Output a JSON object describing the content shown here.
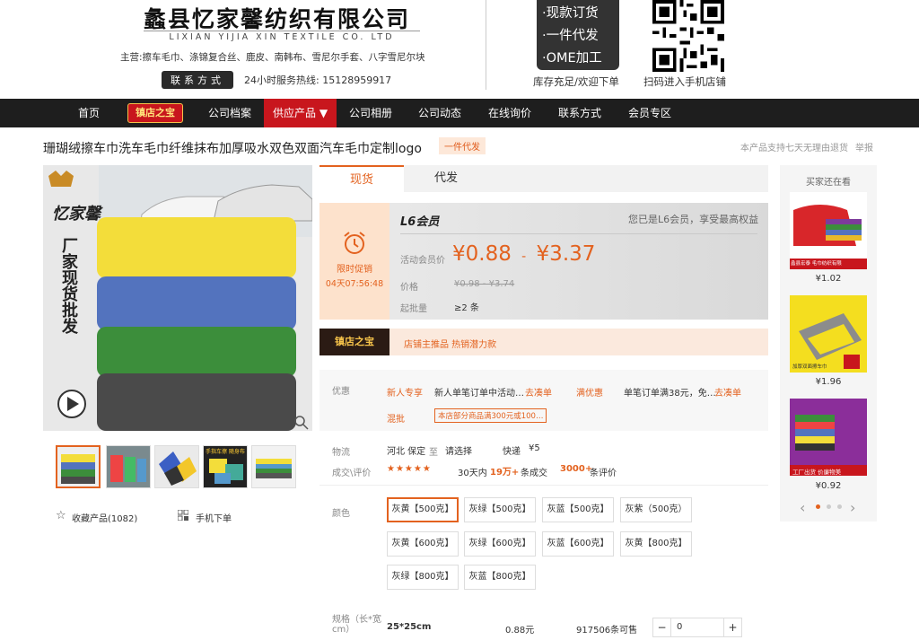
{
  "header": {
    "company": "蠡县忆家馨纺织有限公司",
    "company_en": "LIXIAN YIJIA XIN TEXTILE CO. LTD",
    "main_products": "主营:擦车毛巾、涤锦复合丝、鹿皮、南韩布、雪尼尔手套、八字雪尼尔块",
    "contact_label": "联系方式",
    "hotline": "24小时服务热线: 15128959917",
    "badge_lines": [
      "·现款订货",
      "·一件代发",
      "·OME加工"
    ],
    "stock_text": "库存充足/欢迎下单",
    "qr_caption": "扫码进入手机店铺"
  },
  "nav": {
    "items": [
      "首页",
      "镇店之宝",
      "公司档案",
      "供应产品 ▼",
      "公司相册",
      "公司动态",
      "在线询价",
      "联系方式",
      "会员专区"
    ]
  },
  "product": {
    "title": "珊瑚绒擦车巾洗车毛巾纤维抹布加厚吸水双色双面汽车毛巾定制logo",
    "tag": "一件代发",
    "guarantee": "本产品支持七天无理由退货",
    "report": "举报",
    "favorite": "收藏产品(1082)",
    "mobile_order": "手机下单"
  },
  "tabs": [
    "现货",
    "代发"
  ],
  "price": {
    "promo_title": "限时促销",
    "countdown": "04天07:56:48",
    "member_level": "L6会员",
    "member_info": "您已是L6会员，享受最高权益",
    "activity_label": "活动会员价",
    "activity_low": "¥0.88",
    "activity_dash": "-",
    "activity_high": "¥3.37",
    "price_label": "价格",
    "price_range": "¥0.98 - ¥3.74",
    "moq_label": "起批量",
    "moq": "≥2 条"
  },
  "strip": {
    "badge": "镇店之宝",
    "text": "店铺主推品  热销潜力款"
  },
  "discount": {
    "label": "优惠",
    "newcomer_tag": "新人专享",
    "newcomer_text": "新人单笔订单中活动…",
    "go_coupon": "去凑单",
    "full_tag": "满优惠",
    "full_text": "单笔订单满38元，免…",
    "go_coupon2": "去凑单",
    "mixed_tag": "混批",
    "mixed_text": "本店部分商品满300元或100…"
  },
  "logistics": {
    "label": "物流",
    "from": "河北 保定",
    "to_label": "至",
    "to": "请选择",
    "express": "快递",
    "fee": "¥5"
  },
  "deals": {
    "label": "成交\\评价",
    "stars": "★★★★★",
    "period": "30天内",
    "count": "19万+",
    "count_suffix": "条成交",
    "reviews": "3000+",
    "reviews_suffix": "条评价"
  },
  "colors": {
    "label": "颜色",
    "options": [
      "灰黄【500克】",
      "灰绿【500克】",
      "灰蓝【500克】",
      "灰紫（500克）",
      "灰黄【600克】",
      "灰绿【600克】",
      "灰蓝【600克】",
      "灰黄【800克】",
      "灰绿【800克】",
      "灰蓝【800克】"
    ],
    "selected_index": 0
  },
  "spec": {
    "label": "规格（长*宽cm）",
    "size": "25*25cm",
    "price": "0.88元",
    "stock": "917506条可售",
    "qty": "0",
    "minus": "−",
    "plus": "+"
  },
  "image_text": {
    "brand": "忆家馨",
    "slogan": "厂家现货批发",
    "thumb2_caption": "手指车擦 随身布"
  },
  "side": {
    "title": "买家还在看",
    "items": [
      {
        "price": "¥1.02",
        "caption": "蠡县宏泰 毛巾纺织有限"
      },
      {
        "price": "¥1.96",
        "caption": "加厚双面擦车巾"
      },
      {
        "price": "¥0.92",
        "caption": "工厂出货 价廉物美"
      }
    ]
  },
  "colors_palette": {
    "accent": "#e3621f",
    "nav_bg": "#1e1e1e",
    "nav_active": "#c8161d"
  }
}
